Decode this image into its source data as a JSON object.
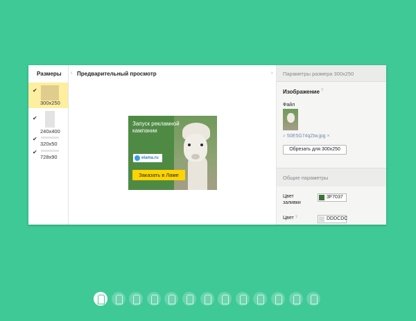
{
  "sizes": {
    "title": "Размеры",
    "items": [
      {
        "label": "300x250",
        "checked": true,
        "selected": true
      },
      {
        "label": "240x400",
        "checked": true,
        "selected": false
      },
      {
        "label": "320x50",
        "checked": true,
        "selected": false
      },
      {
        "label": "728x90",
        "checked": true,
        "selected": false
      }
    ]
  },
  "preview": {
    "title": "Предварительный просмотр",
    "banner": {
      "headline": "Запуск рекламной кампании",
      "logo": "elama.ru",
      "button": "Заказать в Ламе"
    }
  },
  "panel": {
    "header": "Параметры размера 300x250",
    "image_title": "Изображение",
    "file_label": "Файл",
    "file_name": "50E5G74qZtw.jpg",
    "crop_button": "Обрезать для 300x250",
    "general_title": "Общие параметры",
    "fill_label": "Цвет заливки",
    "fill_color": "3F7037",
    "fill_swatch": "#3F7037",
    "border_label": "Цвет",
    "border_color": "DDDCDC",
    "border_swatch": "#DDDCDC"
  },
  "pager": {
    "count": 13,
    "active": 0
  }
}
